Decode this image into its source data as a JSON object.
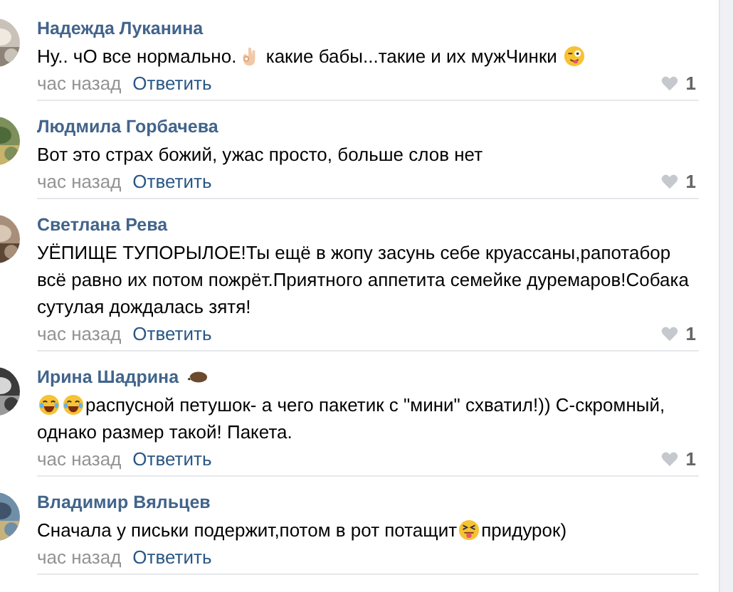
{
  "comments": [
    {
      "author": "Надежда Луканина",
      "avatar": {
        "kind": "picture"
      },
      "body": [
        {
          "kind": "text",
          "text": "Ну.. чО все нормально."
        },
        {
          "kind": "ok"
        },
        {
          "kind": "text",
          "text": " какие бабы...такие и их мужЧинки "
        },
        {
          "kind": "wink"
        }
      ],
      "time": "час назад",
      "reply": "Ответить",
      "likes": "1"
    },
    {
      "author": "Людмила Горбачева",
      "avatar": {
        "kind": "picture"
      },
      "body": [
        {
          "kind": "text",
          "text": "Вот это страх божий, ужас просто, больше слов нет"
        }
      ],
      "time": "час назад",
      "reply": "Ответить",
      "likes": "1"
    },
    {
      "author": "Светлана Рева",
      "avatar": {
        "kind": "picture"
      },
      "body": [
        {
          "kind": "text",
          "text": "УЁПИЩЕ ТУПОРЫЛОЕ!Ты ещё в жопу засунь себе круассаны,рапотабор всё равно их потом пожрёт.Приятного аппетита семейке дуремаров!Собака сутулая дождалась зятя!"
        }
      ],
      "time": "час назад",
      "reply": "Ответить",
      "likes": "1"
    },
    {
      "author": "Ирина Шадрина",
      "badge": true,
      "avatar": {
        "kind": "picture"
      },
      "body": [
        {
          "kind": "laugh"
        },
        {
          "kind": "laugh"
        },
        {
          "kind": "text",
          "text": "распусной петушок- а чего пакетик с \"мини\" схватил!)) С-скромный,"
        },
        {
          "kind": "text",
          "text": "однако размер такой! Пакета."
        }
      ],
      "time": "час назад",
      "reply": "Ответить",
      "likes": "1"
    },
    {
      "author": "Владимир Вяльцев",
      "avatar": {
        "kind": "picture"
      },
      "body": [
        {
          "kind": "text",
          "text": "Сначала у письки подержит,потом в рот потащит"
        },
        {
          "kind": "squint"
        },
        {
          "kind": "text",
          "text": "придурок)"
        }
      ],
      "time": "час назад",
      "reply": "Ответить"
    }
  ]
}
